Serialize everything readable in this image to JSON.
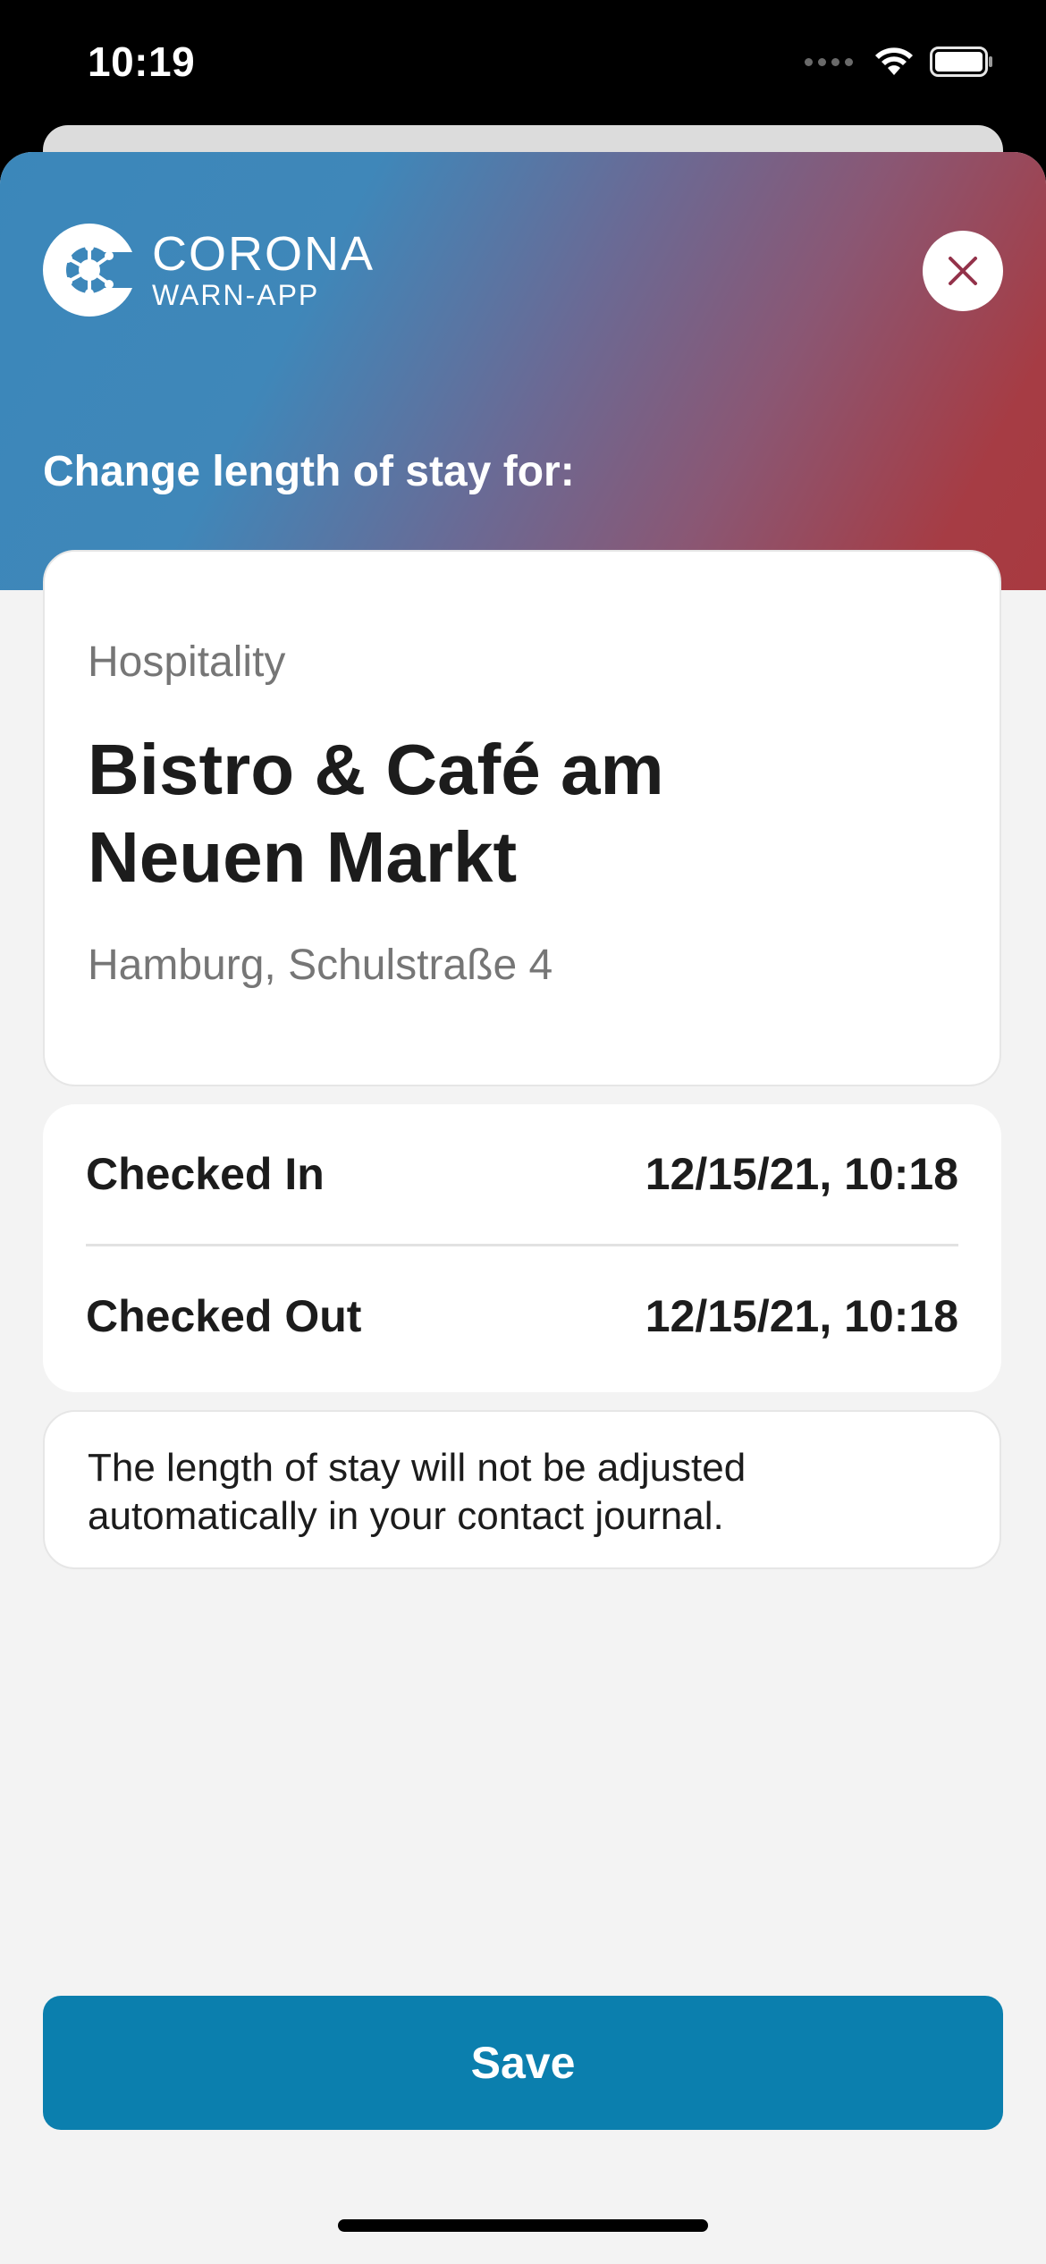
{
  "status_bar": {
    "time": "10:19"
  },
  "header": {
    "logo_title": "CORONA",
    "logo_subtitle": "WARN-APP",
    "close_icon": "close-icon",
    "label": "Change length of stay for:",
    "gradient_colors": [
      "#3b87ba",
      "#a83a40"
    ]
  },
  "location": {
    "category": "Hospitality",
    "name": "Bistro & Café am Neuen Markt",
    "address": "Hamburg, Schulstraße 4"
  },
  "times": {
    "checked_in_label": "Checked In",
    "checked_in_value": "12/15/21, 10:18",
    "checked_out_label": "Checked Out",
    "checked_out_value": "12/15/21, 10:18"
  },
  "notice": {
    "text": "The length of stay will not be adjusted automatically in your contact journal."
  },
  "actions": {
    "save_label": "Save",
    "save_color": "#0b7fae"
  }
}
